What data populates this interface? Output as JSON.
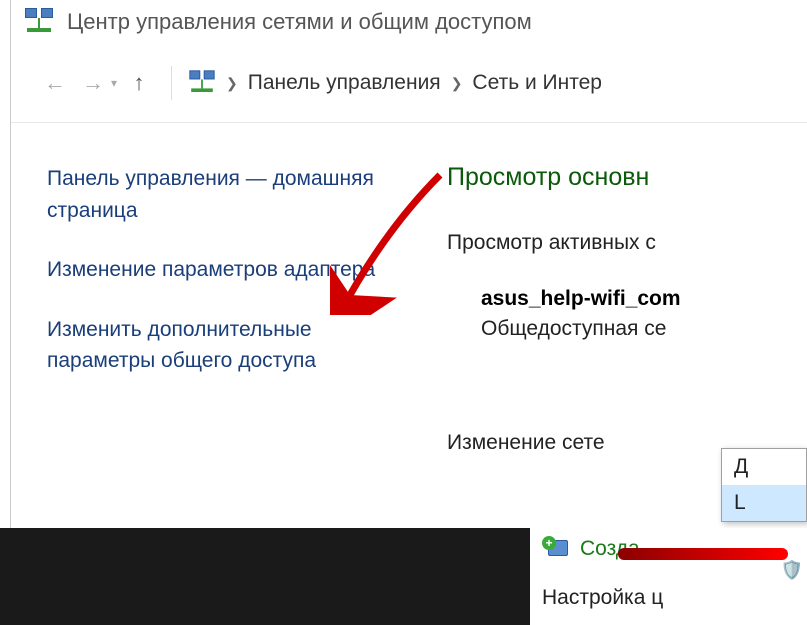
{
  "titlebar": {
    "title": "Центр управления сетями и общим доступом"
  },
  "breadcrumb": {
    "item1": "Панель управления",
    "item2": "Сеть и Интер"
  },
  "sidebar": {
    "home": "Панель управления — домашняя страница",
    "adapter": "Изменение параметров адаптера",
    "sharing": "Изменить дополнительные параметры общего доступа"
  },
  "main": {
    "title": "Просмотр основн",
    "active": "Просмотр активных с",
    "net_name": "asus_help-wifi_com",
    "net_type": "Общедоступная се",
    "change": "Изменение сете"
  },
  "popup": {
    "row1": "Д",
    "row2": "L"
  },
  "below": {
    "create": "Созда",
    "tune": "Настройка ц"
  }
}
